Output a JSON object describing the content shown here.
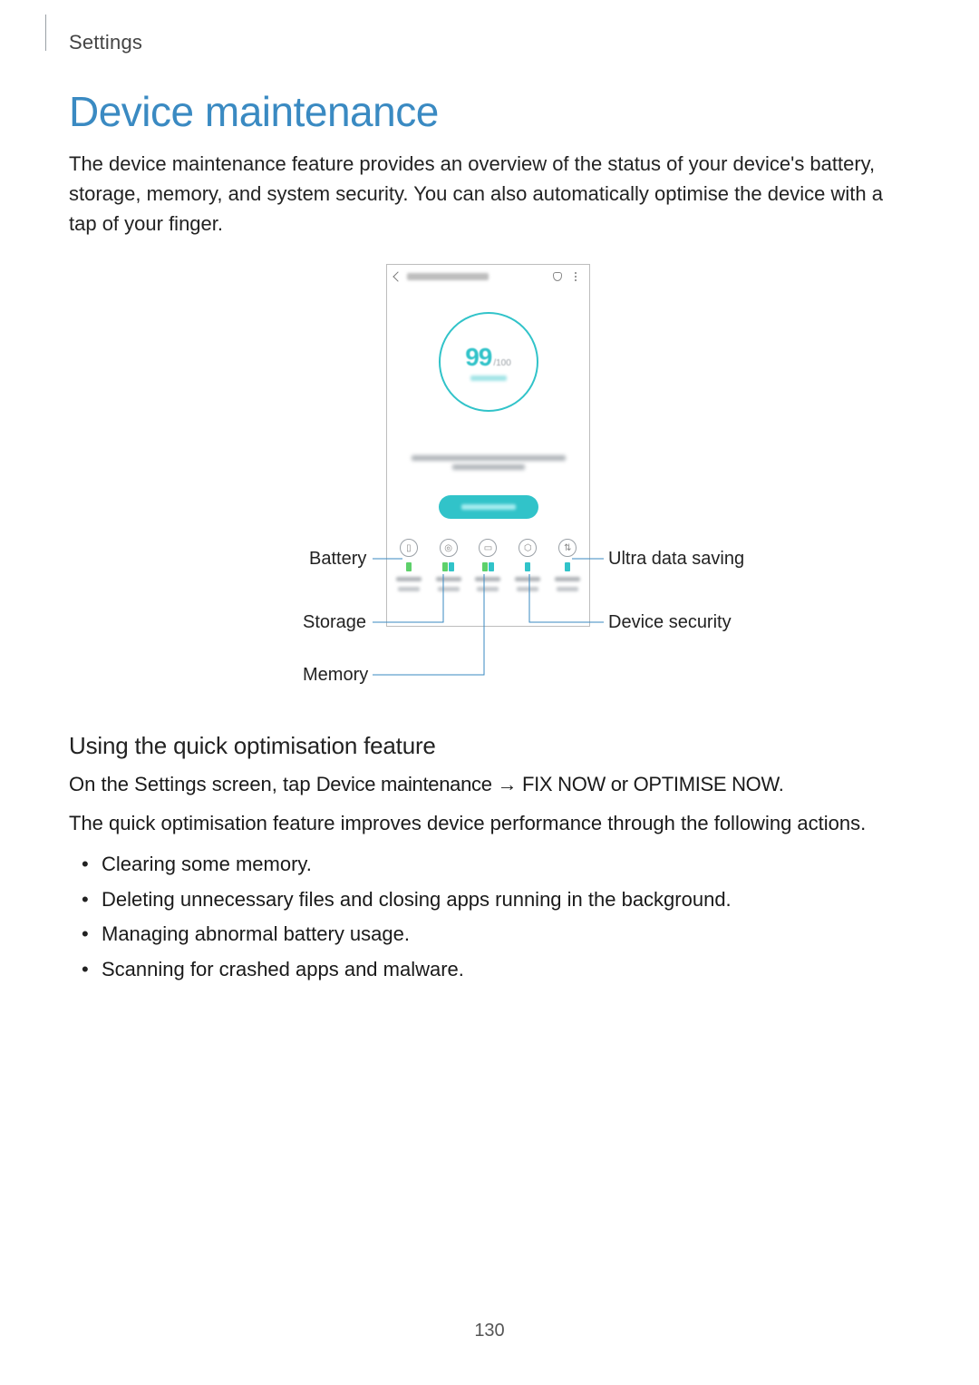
{
  "header": {
    "breadcrumb": "Settings"
  },
  "title": "Device maintenance",
  "intro": "The device maintenance feature provides an overview of the status of your device's battery, storage, memory, and system security. You can also automatically optimise the device with a tap of your finger.",
  "screenshot": {
    "score_num": "99",
    "score_den": "/100"
  },
  "callouts": {
    "battery": "Battery",
    "storage": "Storage",
    "memory": "Memory",
    "ultra": "Ultra data saving",
    "security": "Device security"
  },
  "section2": {
    "heading": "Using the quick optimisation feature",
    "line1_pre": "On the Settings screen, tap ",
    "line1_nav": "Device maintenance → FIX NOW or OPTIMISE NOW.",
    "line2": "The quick optimisation feature improves device performance through the following actions.",
    "bullets": [
      "Clearing some memory.",
      "Deleting unnecessary files and closing apps running in the background.",
      "Managing abnormal battery usage.",
      "Scanning for crashed apps and malware."
    ]
  },
  "page_number": "130"
}
